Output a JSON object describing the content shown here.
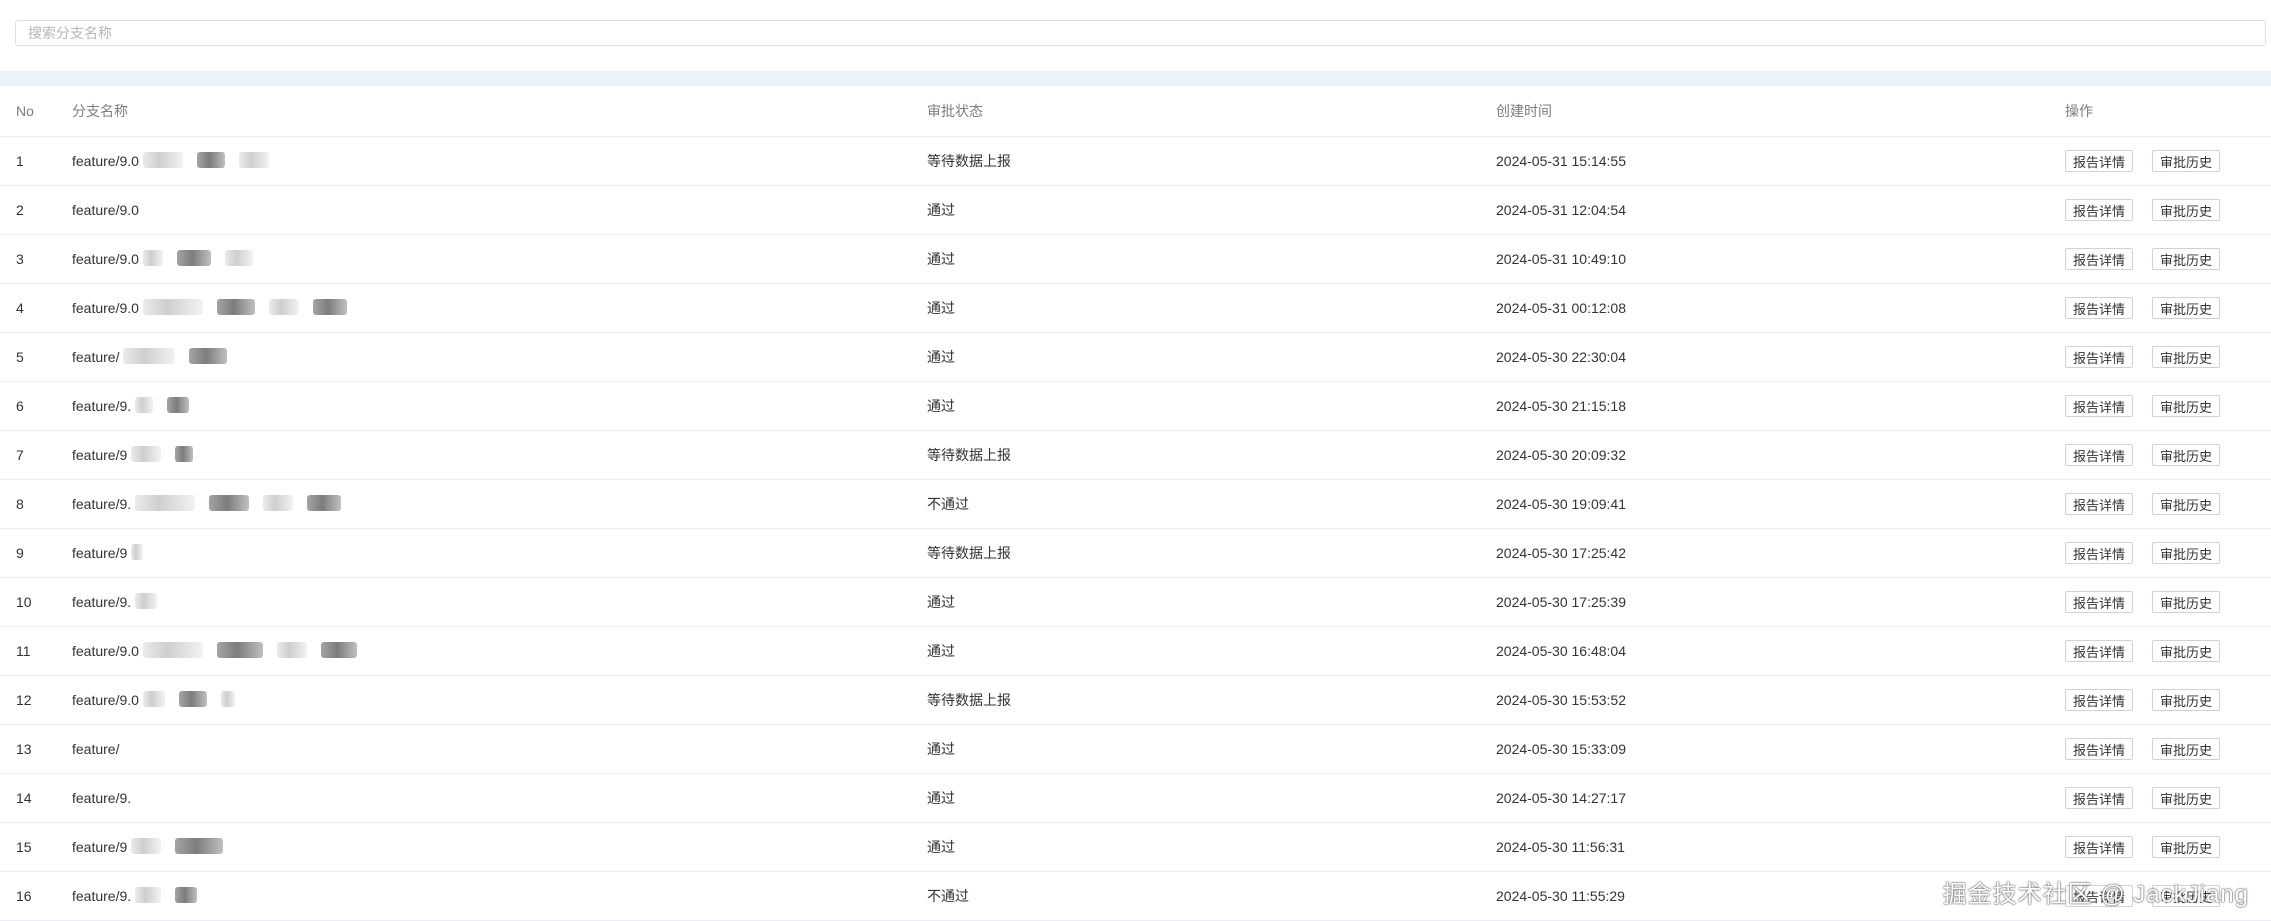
{
  "search": {
    "placeholder": "搜索分支名称",
    "value": ""
  },
  "table": {
    "headers": {
      "no": "No",
      "branch": "分支名称",
      "status": "审批状态",
      "created": "创建时间",
      "ops": "操作"
    },
    "buttons": {
      "detail": "报告详情",
      "history": "审批历史"
    },
    "rows": [
      {
        "no": "1",
        "branch": "feature/9.0",
        "status": "等待数据上报",
        "created": "2024-05-31 15:14:55"
      },
      {
        "no": "2",
        "branch": "feature/9.0",
        "status": "通过",
        "created": "2024-05-31 12:04:54"
      },
      {
        "no": "3",
        "branch": "feature/9.0",
        "status": "通过",
        "created": "2024-05-31 10:49:10"
      },
      {
        "no": "4",
        "branch": "feature/9.0",
        "status": "通过",
        "created": "2024-05-31 00:12:08"
      },
      {
        "no": "5",
        "branch": "feature/",
        "status": "通过",
        "created": "2024-05-30 22:30:04"
      },
      {
        "no": "6",
        "branch": "feature/9.",
        "status": "通过",
        "created": "2024-05-30 21:15:18"
      },
      {
        "no": "7",
        "branch": "feature/9",
        "status": "等待数据上报",
        "created": "2024-05-30 20:09:32"
      },
      {
        "no": "8",
        "branch": "feature/9.",
        "status": "不通过",
        "created": "2024-05-30 19:09:41"
      },
      {
        "no": "9",
        "branch": "feature/9",
        "status": "等待数据上报",
        "created": "2024-05-30 17:25:42"
      },
      {
        "no": "10",
        "branch": "feature/9.",
        "status": "通过",
        "created": "2024-05-30 17:25:39"
      },
      {
        "no": "11",
        "branch": "feature/9.0",
        "status": "通过",
        "created": "2024-05-30 16:48:04"
      },
      {
        "no": "12",
        "branch": "feature/9.0",
        "status": "等待数据上报",
        "created": "2024-05-30 15:53:52"
      },
      {
        "no": "13",
        "branch": "feature/",
        "status": "通过",
        "created": "2024-05-30 15:33:09"
      },
      {
        "no": "14",
        "branch": "feature/9.",
        "status": "通过",
        "created": "2024-05-30 14:27:17"
      },
      {
        "no": "15",
        "branch": "feature/9",
        "status": "通过",
        "created": "2024-05-30 11:56:31"
      },
      {
        "no": "16",
        "branch": "feature/9.",
        "status": "不通过",
        "created": "2024-05-30 11:55:29"
      }
    ]
  },
  "watermark": "掘金技术社区 @ JackJiang"
}
